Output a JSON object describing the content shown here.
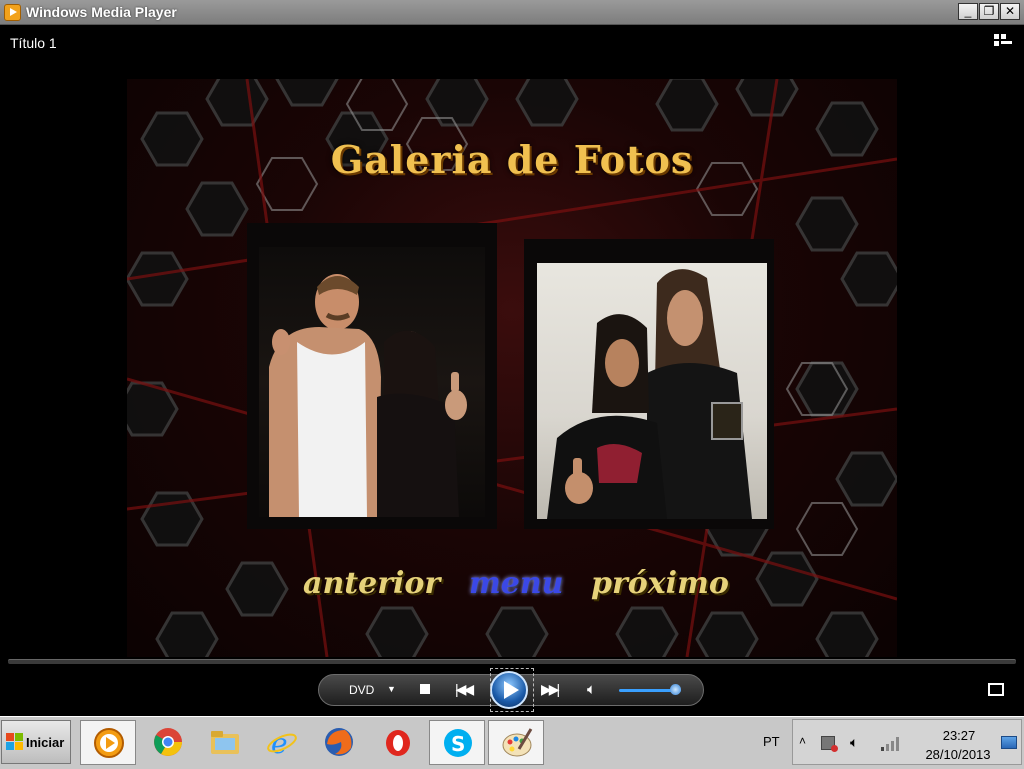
{
  "window": {
    "title": "Windows Media Player",
    "buttons": {
      "minimize": "_",
      "restore": "❐",
      "close": "✕"
    }
  },
  "player": {
    "title_label": "Título 1",
    "menu": {
      "heading": "Galeria de Fotos",
      "nav": {
        "previous": "anterior",
        "menu": "menu",
        "next": "próximo"
      }
    },
    "controls": {
      "source": "DVD",
      "volume_level": 0.9
    }
  },
  "taskbar": {
    "start_label": "Iniciar",
    "apps": [
      {
        "name": "windows-media-player-icon"
      },
      {
        "name": "chrome-icon"
      },
      {
        "name": "explorer-icon"
      },
      {
        "name": "internet-explorer-icon"
      },
      {
        "name": "firefox-icon"
      },
      {
        "name": "opera-icon"
      },
      {
        "name": "skype-icon"
      },
      {
        "name": "paint-icon"
      }
    ],
    "language": "PT",
    "tray": {
      "expand": "˄",
      "time": "23:27",
      "date": "28/10/2013"
    }
  },
  "colors": {
    "accent_gold": "#f0c050",
    "menu_highlight": "#3b48e6",
    "volume": "#3aa0ff"
  }
}
